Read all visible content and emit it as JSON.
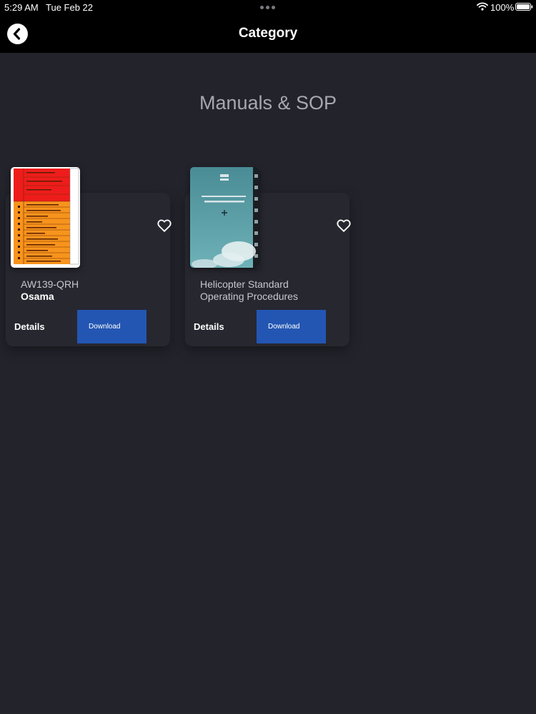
{
  "status_bar": {
    "time": "5:29 AM",
    "date": "Tue Feb 22",
    "battery": "100%"
  },
  "nav": {
    "title": "Category",
    "back_icon": "chevron-left-icon"
  },
  "section": {
    "title": "Manuals & SOP"
  },
  "items": [
    {
      "title": "AW139-QRH",
      "author": "Osama",
      "details_label": "Details",
      "download_label": "Download",
      "favorite_icon": "heart-outline-icon"
    },
    {
      "title": "Helicopter Standard Operating Procedures",
      "author": "",
      "details_label": "Details",
      "download_label": "Download",
      "favorite_icon": "heart-outline-icon"
    }
  ],
  "colors": {
    "background": "#23232c",
    "card": "#272730",
    "topbar": "#000000",
    "download_button": "#2356b3",
    "section_title": "#a7a7ae"
  }
}
